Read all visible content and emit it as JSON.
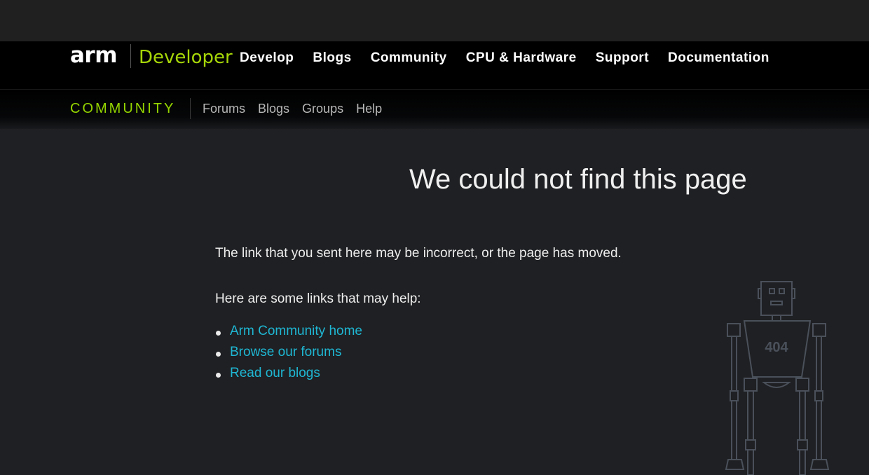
{
  "header": {
    "logo_arm": "arm",
    "logo_developer": "Developer",
    "nav": [
      "Develop",
      "Blogs",
      "Community",
      "CPU & Hardware",
      "Support",
      "Documentation"
    ]
  },
  "subnav": {
    "title": "COMMUNITY",
    "items": [
      "Forums",
      "Blogs",
      "Groups",
      "Help"
    ]
  },
  "main": {
    "headline": "We could not find this page",
    "message": "The link that you sent here may be incorrect, or the page has moved.",
    "links_intro": "Here are some links that may help:",
    "links": [
      "Arm Community home",
      "Browse our forums",
      "Read our blogs"
    ],
    "robot_label": "404"
  },
  "colors": {
    "brand_green": "#95d600",
    "link_blue": "#1fb7d4",
    "background": "#1f2023"
  }
}
